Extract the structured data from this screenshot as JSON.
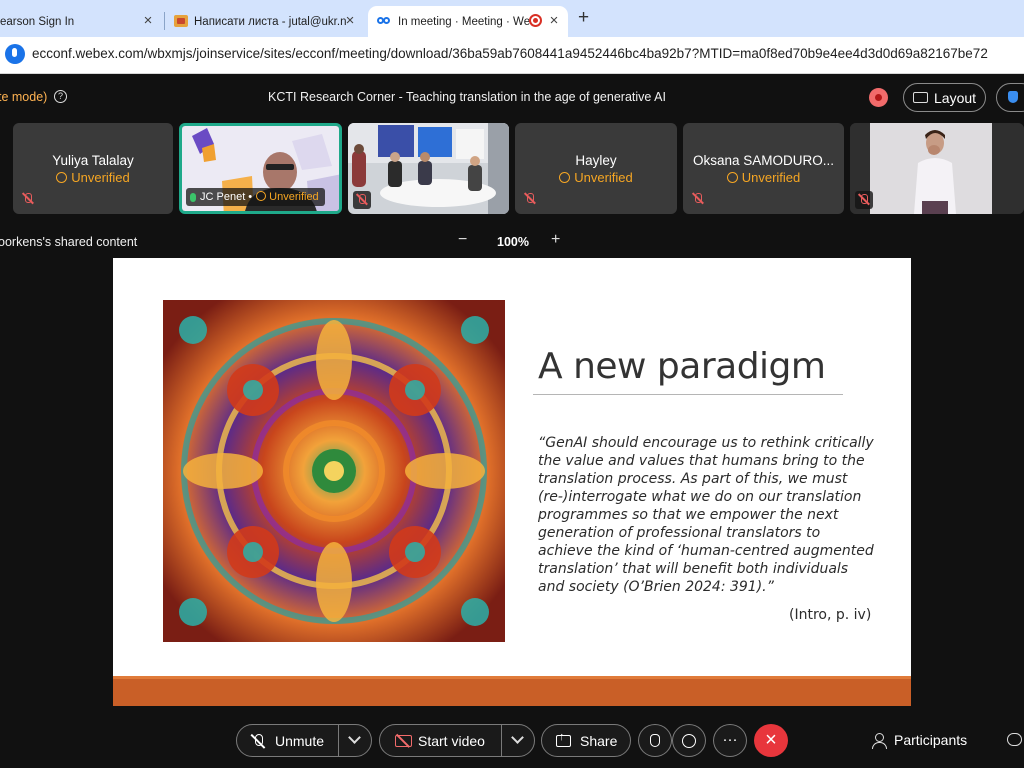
{
  "browser": {
    "tabs": [
      {
        "label": "earson Sign In",
        "active": false
      },
      {
        "label": "Написати листа - jutal@ukr.n",
        "active": false
      },
      {
        "label": "In meeting · Meeting · We",
        "active": true
      }
    ],
    "new_tab": "+",
    "close_glyph": "×",
    "url": "ecconf.webex.com/wbxmjs/joinservice/sites/ecconf/meeting/download/36ba59ab7608441a9452446bc4ba92b7?MTID=ma0f8ed70b9e4ee4d3d0d69a82167be72"
  },
  "meeting": {
    "mode_label": "te mode)",
    "help": "?",
    "title": "KCTI Research Corner - Teaching translation in the age of generative AI",
    "layout_label": "Layout"
  },
  "participants": [
    {
      "name": "Yuliya Talalay",
      "status": "Unverified",
      "video": false
    },
    {
      "name": "JC Penet •",
      "status": "Unverified",
      "video": true,
      "active": true
    },
    {
      "name": "",
      "status": "",
      "video": true
    },
    {
      "name": "Hayley",
      "status": "Unverified",
      "video": false
    },
    {
      "name": "Oksana SAMODURO...",
      "status": "Unverified",
      "video": false
    },
    {
      "name": "",
      "status": "",
      "video": true
    }
  ],
  "shared_content": {
    "label": "oorkens's shared content",
    "zoom_minus": "−",
    "zoom": "100%",
    "zoom_plus": "+"
  },
  "slide": {
    "title": "A new paradigm",
    "quote": "“GenAI should encourage us to rethink critically the value and values that humans bring to the translation process. As part of this, we must (re-)interrogate what we do on our translation programmes so that we empower the next generation of professional translators to achieve the kind of ‘human-centred augmented translation’ that will benefit both individuals and society (O’Brien 2024: 391).”",
    "citation": "(Intro, p. iv)"
  },
  "controls": {
    "unmute": "Unmute",
    "start_video": "Start video",
    "share": "Share",
    "participants": "Participants",
    "end": "×",
    "more": "···"
  },
  "colors": {
    "accent_orange": "#f6a623",
    "active_border": "#1fa98a",
    "end_red": "#e8363c",
    "slide_footer": "#c95f27"
  }
}
